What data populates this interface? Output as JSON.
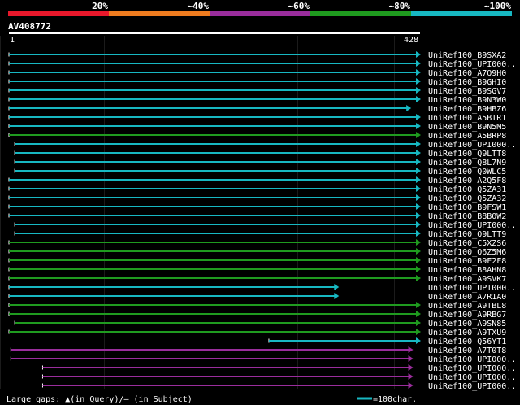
{
  "legend": {
    "labels": [
      "20%",
      "~40%",
      "~60%",
      "~80%",
      "~100%"
    ],
    "colors": [
      "#e8182b",
      "#ef7c1f",
      "#9a2d9c",
      "#1f9b1f",
      "#17b8c2"
    ]
  },
  "query": {
    "name": "AV408772",
    "start_label": "1",
    "end_label": "428",
    "length": 428
  },
  "footer": {
    "gaps_note": "Large gaps: ▲(in Query)/— (in Subject)",
    "scale_note": "=100char."
  },
  "hits": [
    {
      "label": "UniRef100_B9SXA2",
      "color": "cyan",
      "start": 1,
      "end": 428
    },
    {
      "label": "UniRef100_UPI000..",
      "color": "cyan",
      "start": 1,
      "end": 428
    },
    {
      "label": "UniRef100_A7Q9H0",
      "color": "cyan",
      "start": 1,
      "end": 428
    },
    {
      "label": "UniRef100_B9GHI0",
      "color": "cyan",
      "start": 1,
      "end": 428
    },
    {
      "label": "UniRef100_B9SGV7",
      "color": "cyan",
      "start": 1,
      "end": 428
    },
    {
      "label": "UniRef100_B9N3W0",
      "color": "cyan",
      "start": 1,
      "end": 428
    },
    {
      "label": "UniRef100_B9HBZ6",
      "color": "cyan",
      "start": 1,
      "end": 418
    },
    {
      "label": "UniRef100_A5BIR1",
      "color": "cyan",
      "start": 1,
      "end": 428
    },
    {
      "label": "UniRef100_B9N5M5",
      "color": "cyan",
      "start": 1,
      "end": 428
    },
    {
      "label": "UniRef100_A5BRP8",
      "color": "green",
      "start": 1,
      "end": 428
    },
    {
      "label": "UniRef100_UPI000..",
      "color": "cyan",
      "start": 7,
      "end": 428
    },
    {
      "label": "UniRef100_Q9LTT8",
      "color": "cyan",
      "start": 7,
      "end": 428
    },
    {
      "label": "UniRef100_Q8L7N9",
      "color": "cyan",
      "start": 7,
      "end": 428
    },
    {
      "label": "UniRef100_Q0WLC5",
      "color": "cyan",
      "start": 7,
      "end": 428
    },
    {
      "label": "UniRef100_A2Q5F8",
      "color": "cyan",
      "start": 1,
      "end": 428
    },
    {
      "label": "UniRef100_Q5ZA31",
      "color": "cyan",
      "start": 1,
      "end": 428
    },
    {
      "label": "UniRef100_Q5ZA32",
      "color": "cyan",
      "start": 1,
      "end": 428
    },
    {
      "label": "UniRef100_B9FSW1",
      "color": "cyan",
      "start": 1,
      "end": 428
    },
    {
      "label": "UniRef100_B8B0W2",
      "color": "cyan",
      "start": 1,
      "end": 428
    },
    {
      "label": "UniRef100_UPI000..",
      "color": "cyan",
      "start": 7,
      "end": 428
    },
    {
      "label": "UniRef100_Q9LTT9",
      "color": "cyan",
      "start": 7,
      "end": 428
    },
    {
      "label": "UniRef100_C5XZS6",
      "color": "green",
      "start": 1,
      "end": 428
    },
    {
      "label": "UniRef100_Q6Z5M6",
      "color": "green",
      "start": 1,
      "end": 428
    },
    {
      "label": "UniRef100_B9F2F8",
      "color": "green",
      "start": 1,
      "end": 428
    },
    {
      "label": "UniRef100_B8AHN8",
      "color": "green",
      "start": 1,
      "end": 428
    },
    {
      "label": "UniRef100_A9SVK7",
      "color": "green",
      "start": 1,
      "end": 428
    },
    {
      "label": "UniRef100_UPI000..",
      "color": "cyan",
      "start": 1,
      "end": 343
    },
    {
      "label": "UniRef100_A7R1A0",
      "color": "cyan",
      "start": 1,
      "end": 343
    },
    {
      "label": "UniRef100_A9TBL8",
      "color": "green",
      "start": 1,
      "end": 428
    },
    {
      "label": "UniRef100_A9RBG7",
      "color": "green",
      "start": 1,
      "end": 428
    },
    {
      "label": "UniRef100_A9SN85",
      "color": "green",
      "start": 7,
      "end": 428
    },
    {
      "label": "UniRef100_A9TXU9",
      "color": "green",
      "start": 1,
      "end": 428
    },
    {
      "label": "UniRef100_Q56YT1",
      "color": "cyan",
      "start": 271,
      "end": 428
    },
    {
      "label": "UniRef100_A7T0T8",
      "color": "purple",
      "start": 3,
      "end": 420
    },
    {
      "label": "UniRef100_UPI000..",
      "color": "purple",
      "start": 3,
      "end": 420
    },
    {
      "label": "UniRef100_UPI000..",
      "color": "purple",
      "start": 36,
      "end": 420
    },
    {
      "label": "UniRef100_UPI000..",
      "color": "purple",
      "start": 36,
      "end": 420
    },
    {
      "label": "UniRef100_UPI000..",
      "color": "purple",
      "start": 36,
      "end": 420
    }
  ]
}
